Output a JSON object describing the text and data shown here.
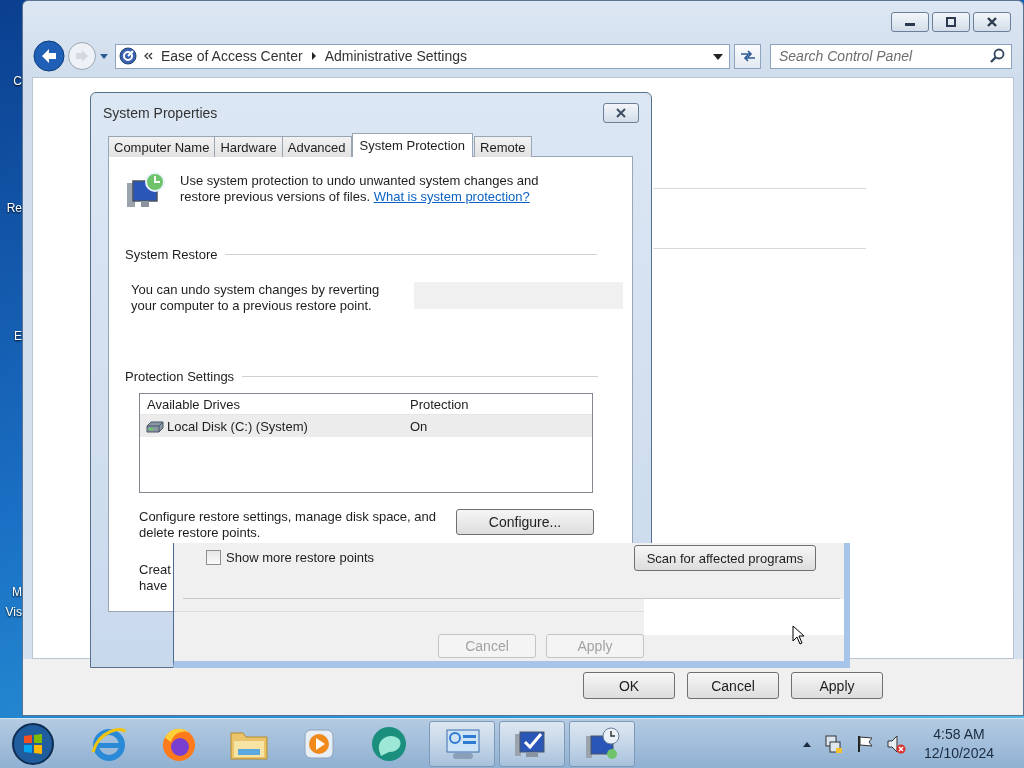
{
  "desktop": {
    "icon_labels": [
      "C",
      "Re",
      "E",
      "M",
      "Vis"
    ]
  },
  "explorer": {
    "breadcrumb": [
      "Ease of Access Center",
      "Administrative Settings"
    ],
    "search": {
      "placeholder": "Search Control Panel"
    },
    "buttons": [
      "OK",
      "Cancel",
      "Apply"
    ]
  },
  "dialog": {
    "title": "System Properties",
    "tabs": [
      {
        "label": "Computer Name",
        "selected": false
      },
      {
        "label": "Hardware",
        "selected": false
      },
      {
        "label": "Advanced",
        "selected": false
      },
      {
        "label": "System Protection",
        "selected": true
      },
      {
        "label": "Remote",
        "selected": false
      }
    ],
    "intro": "Use system protection to undo unwanted system changes and restore previous versions of files.",
    "link": "What is system protection?",
    "system_restore": {
      "heading": "System Restore",
      "text": "You can undo system changes by reverting your computer to a previous restore point."
    },
    "protection": {
      "heading": "Protection Settings",
      "columns": [
        "Available Drives",
        "Protection"
      ],
      "rows": [
        {
          "drive": "Local Disk (C:) (System)",
          "protection": "On",
          "selected": true
        }
      ]
    },
    "configure": {
      "text": "Configure restore settings, manage disk space, and delete restore points.",
      "button": "Configure..."
    },
    "create_text": [
      "Creat",
      "have"
    ]
  },
  "overlay": {
    "checkbox": {
      "label": "Show more restore points",
      "checked": false
    },
    "scan_button": "Scan for affected programs",
    "buttons": [
      {
        "label": "Cancel",
        "disabled": true
      },
      {
        "label": "Apply",
        "disabled": true
      }
    ]
  },
  "taskbar": {
    "clock": {
      "time": "4:58 AM",
      "date": "12/10/2024"
    }
  }
}
